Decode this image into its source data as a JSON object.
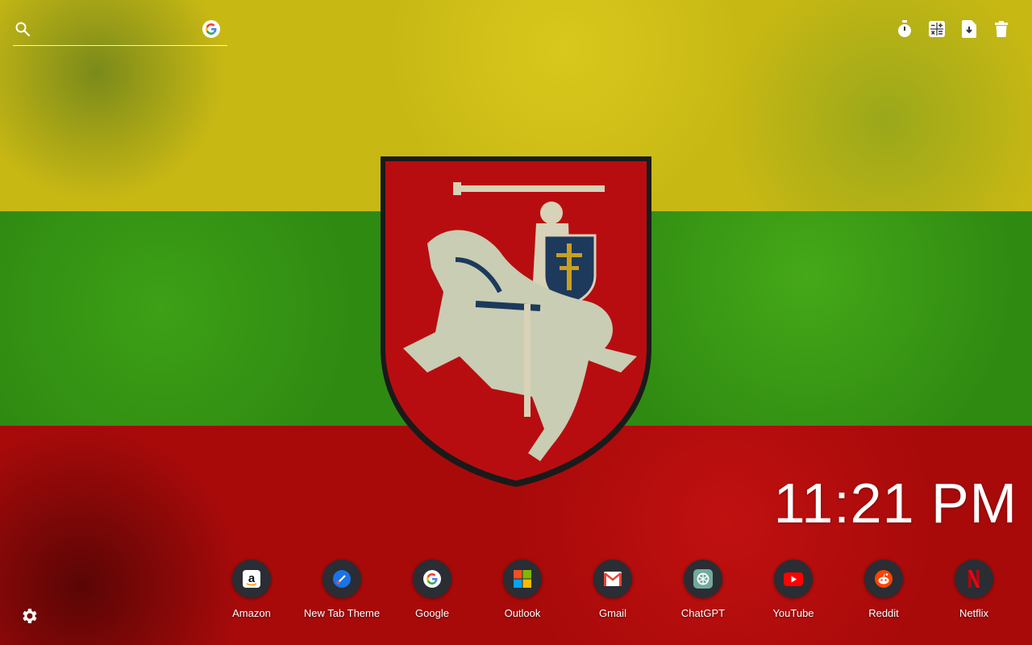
{
  "search": {
    "placeholder": "",
    "engine_icon": "google-g-icon"
  },
  "toolbar": [
    {
      "name": "timer-icon"
    },
    {
      "name": "calculator-icon"
    },
    {
      "name": "file-download-icon"
    },
    {
      "name": "trash-icon"
    }
  ],
  "background": {
    "flag_colors": [
      "#c8b814",
      "#2f8a12",
      "#a80a0a"
    ],
    "emblem": "vytis-coat-of-arms"
  },
  "clock": {
    "time": "11:21 PM"
  },
  "shortcuts": [
    {
      "label": "Amazon",
      "icon": "amazon-icon"
    },
    {
      "label": "New Tab Theme",
      "icon": "new-tab-theme-icon"
    },
    {
      "label": "Google",
      "icon": "google-icon"
    },
    {
      "label": "Outlook",
      "icon": "outlook-icon"
    },
    {
      "label": "Gmail",
      "icon": "gmail-icon"
    },
    {
      "label": "ChatGPT",
      "icon": "chatgpt-icon"
    },
    {
      "label": "YouTube",
      "icon": "youtube-icon"
    },
    {
      "label": "Reddit",
      "icon": "reddit-icon"
    },
    {
      "label": "Netflix",
      "icon": "netflix-icon"
    }
  ],
  "settings": {
    "icon": "gear-icon"
  }
}
